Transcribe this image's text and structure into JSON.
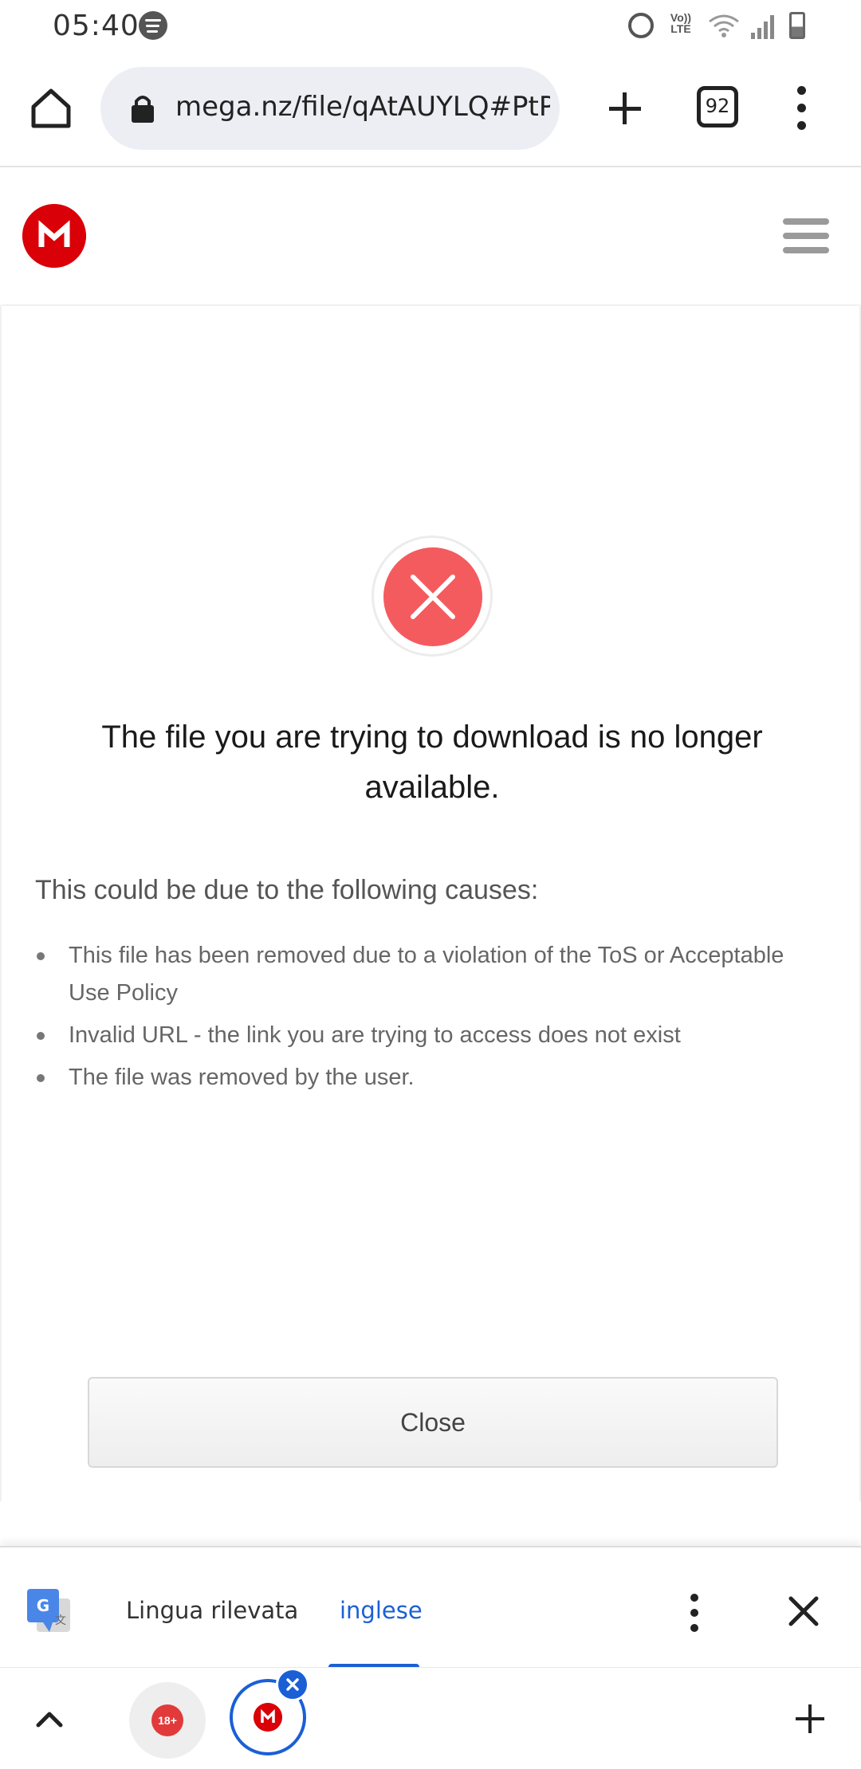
{
  "status_bar": {
    "time": "05:40",
    "volte_label_top": "Vo))",
    "volte_label_bottom": "LTE"
  },
  "browser": {
    "url": "mega.nz/file/qAtAUYLQ#PtPco",
    "tab_count": "92"
  },
  "error": {
    "title": "The file you are trying to download is no longer available.",
    "causes_heading": "This could be due to the following causes:",
    "causes": [
      "This file has been removed due to a violation of the ToS or Acceptable Use Policy",
      "Invalid URL - the link you are trying to access does not exist",
      "The file was removed by the user."
    ],
    "close_label": "Close"
  },
  "translate_bar": {
    "detected_label": "Lingua rilevata",
    "selected_language": "inglese"
  },
  "tab_strip": {
    "tab1_badge": "18+"
  },
  "colors": {
    "mega_red": "#d90007",
    "error_red": "#f45b5f",
    "accent_blue": "#1a5fd6"
  }
}
